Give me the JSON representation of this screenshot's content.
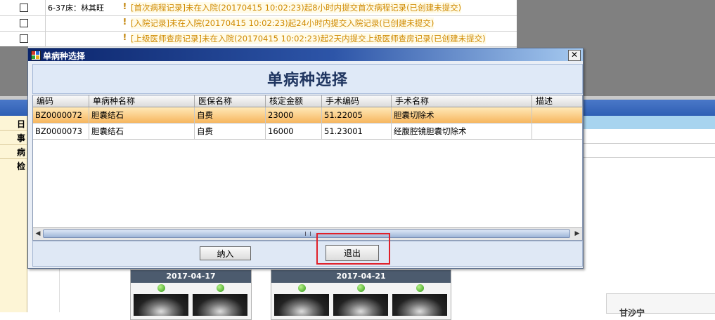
{
  "background": {
    "warnings": [
      {
        "bed": "6-37床：林其旺",
        "text": "[首次病程记录]未在入院(20170415  10:02:23)起8小时内提交首次病程记录(已创建未提交)"
      },
      {
        "bed": "",
        "text": "[入院记录]未在入院(20170415  10:02:23)起24小时内提交入院记录(已创建未提交)"
      },
      {
        "bed": "",
        "text": "[上级医师查房记录]未在入院(20170415  10:02:23)起2天内提交上级医师查房记录(已创建未提交)"
      }
    ],
    "warning_mark": "!",
    "side_labels": [
      "日",
      "事",
      "病",
      "检"
    ],
    "panels": [
      {
        "date": "2017-04-17"
      },
      {
        "date": "2017-04-21"
      }
    ],
    "side_box_text": "甘沙宁"
  },
  "dialog": {
    "title": "单病种选择",
    "close_label": "✕",
    "header": "单病种选择",
    "columns": [
      "编码",
      "单病种名称",
      "医保名称",
      "核定金额",
      "手术编码",
      "手术名称",
      "描述"
    ],
    "rows": [
      [
        "BZ0000072",
        "胆囊结石",
        "自费",
        "23000",
        "51.22005",
        "胆囊切除术",
        ""
      ],
      [
        "BZ0000073",
        "胆囊结石",
        "自费",
        "16000",
        "51.23001",
        "经腹腔镜胆囊切除术",
        ""
      ]
    ],
    "selected_row": 0,
    "confirm_label": "纳入",
    "exit_label": "退出"
  },
  "colors": {
    "highlight_box": "#e0202a",
    "selected_row": "#f7b65f",
    "warning_text": "#d08a00"
  }
}
